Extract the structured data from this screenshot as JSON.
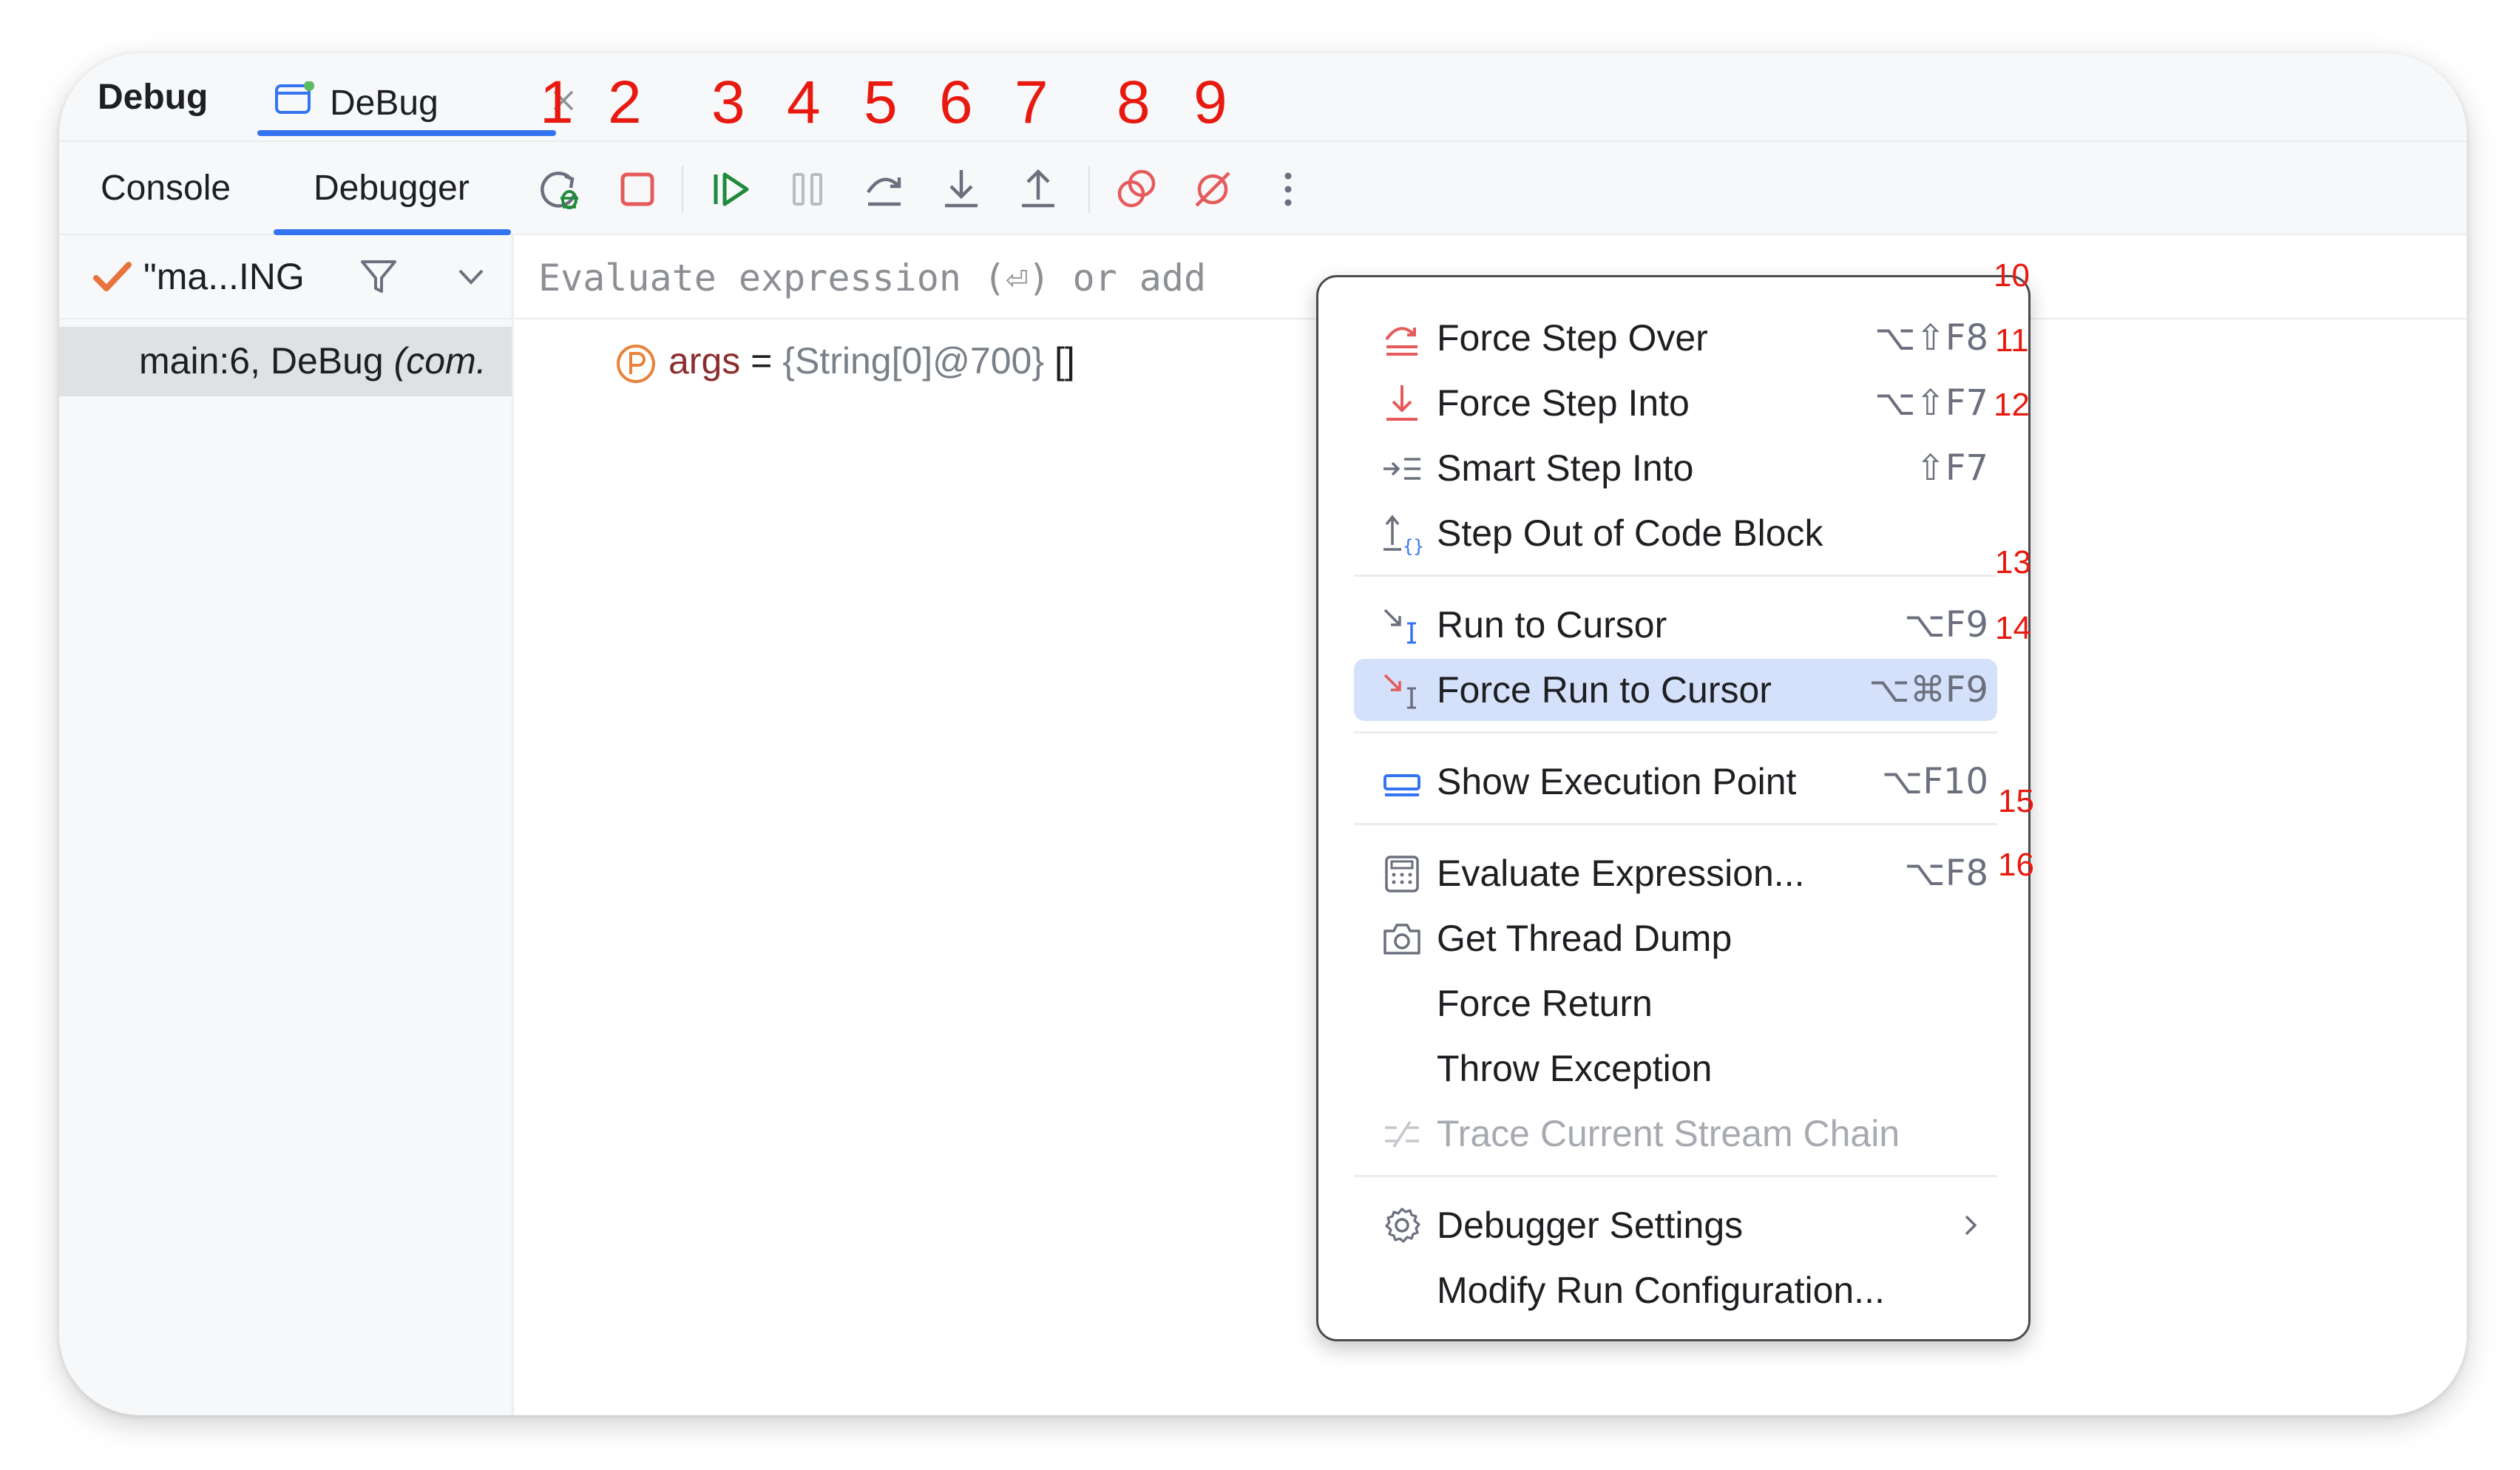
{
  "window": {
    "title": "Debug",
    "session_tab": {
      "label": "DeBug"
    }
  },
  "toolbar_callouts": [
    "1",
    "2",
    "3",
    "4",
    "5",
    "6",
    "7",
    "8",
    "9"
  ],
  "subtabs": {
    "console": "Console",
    "debugger": "Debugger"
  },
  "toolbar_buttons": [
    {
      "name": "rerun-debug-icon",
      "color": "#208a3c"
    },
    {
      "name": "stop-icon",
      "color": "#e55b5b"
    },
    {
      "name": "resume-icon",
      "color": "#208a3c"
    },
    {
      "name": "pause-icon",
      "color": "#a7aab0"
    },
    {
      "name": "step-over-icon",
      "color": "#6c707e"
    },
    {
      "name": "step-into-icon",
      "color": "#6c707e"
    },
    {
      "name": "step-out-icon",
      "color": "#6c707e"
    },
    {
      "name": "view-breakpoints-icon",
      "color": "#e55b5b"
    },
    {
      "name": "mute-breakpoints-icon",
      "color": "#e55b5b"
    },
    {
      "name": "more-icon",
      "color": "#6c707e"
    }
  ],
  "frames": {
    "thread_name": "\"ma...ING",
    "selected_frame_prefix": "main:6, DeBug ",
    "selected_frame_italic": "(com."
  },
  "evaluate": {
    "placeholder": "Evaluate expression (⏎) or add"
  },
  "variable": {
    "name": "args",
    "eq": " = ",
    "type": "{String[0]@700}",
    "value": " []"
  },
  "menu": {
    "items": [
      {
        "label": "Force Step Over",
        "shortcut": "⌥⇧F8",
        "icon": "force-step-over-icon",
        "callout": "10"
      },
      {
        "label": "Force Step Into",
        "shortcut": "⌥⇧F7",
        "icon": "force-step-into-icon",
        "callout": "11"
      },
      {
        "label": "Smart Step Into",
        "shortcut": "⇧F7",
        "icon": "smart-step-into-icon",
        "callout": "12"
      },
      {
        "label": "Step Out of Code Block",
        "shortcut": "",
        "icon": "step-out-code-block-icon",
        "callout": ""
      },
      {
        "label": "Run to Cursor",
        "shortcut": "⌥F9",
        "icon": "run-to-cursor-icon",
        "callout": "13"
      },
      {
        "label": "Force Run to Cursor",
        "shortcut": "⌥⌘F9",
        "icon": "force-run-to-cursor-icon",
        "callout": "14",
        "selected": true
      },
      {
        "label": "Show Execution Point",
        "shortcut": "⌥F10",
        "icon": "show-execution-point-icon",
        "callout": ""
      },
      {
        "label": "Evaluate Expression...",
        "shortcut": "⌥F8",
        "icon": "calculator-icon",
        "callout": "15"
      },
      {
        "label": "Get Thread Dump",
        "shortcut": "",
        "icon": "camera-icon",
        "callout": "16"
      },
      {
        "label": "Force Return",
        "shortcut": "",
        "icon": "",
        "callout": ""
      },
      {
        "label": "Throw Exception",
        "shortcut": "",
        "icon": "",
        "callout": ""
      },
      {
        "label": "Trace Current Stream Chain",
        "shortcut": "",
        "icon": "stream-chain-icon",
        "callout": "",
        "disabled": true
      },
      {
        "label": "Debugger Settings",
        "shortcut": "",
        "icon": "gear-icon",
        "callout": "",
        "submenu": true
      },
      {
        "label": "Modify Run Configuration...",
        "shortcut": "",
        "icon": "",
        "callout": ""
      }
    ]
  },
  "colors": {
    "accent": "#3574f0",
    "callout": "#e8190f",
    "selection": "#d5e1fb"
  }
}
